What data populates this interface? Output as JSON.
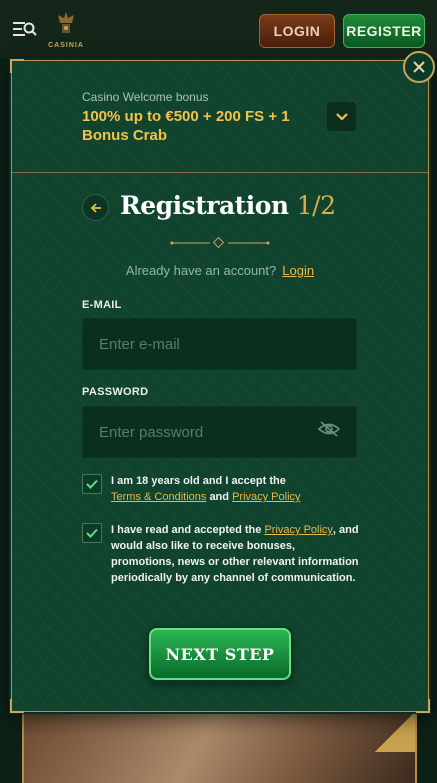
{
  "header": {
    "logo_text": "CASINIA",
    "login_label": "LOGIN",
    "register_label": "REGISTER"
  },
  "bonus": {
    "label": "Casino Welcome bonus",
    "title": "100% up to €500 + 200 FS + 1 Bonus Crab"
  },
  "form": {
    "title": "Registration",
    "step": "1/2",
    "account_prompt": "Already have an account?",
    "login_link": "Login",
    "email_label": "E-MAIL",
    "email_placeholder": "Enter e-mail",
    "password_label": "PASSWORD",
    "password_placeholder": "Enter password",
    "consent1_a": "I am 18 years old and I accept the",
    "consent1_terms": "Terms & Conditions",
    "consent1_and": "and",
    "consent1_privacy": "Privacy Policy",
    "consent2_a": "I have read and accepted the",
    "consent2_privacy": "Privacy Policy",
    "consent2_b": ", and would also like to receive bonuses, promotions, news or other relevant information periodically by any channel of communication.",
    "next_label": "NEXT STEP"
  },
  "colors": {
    "gold": "#e7b948",
    "modal_bg": "#11442e",
    "accent_green": "#2cb552"
  },
  "icons": [
    "menu-search-icon",
    "crown-logo-icon",
    "close-icon",
    "chevron-down-icon",
    "arrow-left-icon",
    "eye-off-icon",
    "check-icon"
  ]
}
